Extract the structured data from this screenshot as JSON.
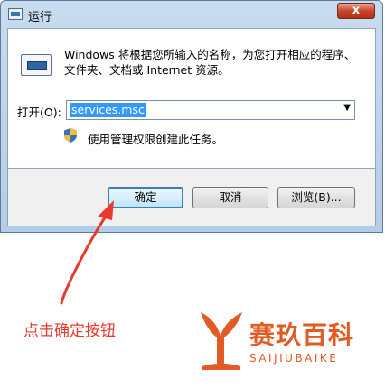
{
  "window": {
    "title": "运行",
    "close_label": "x"
  },
  "dialog": {
    "description": "Windows 将根据您所输入的名称，为您打开相应的程序、文件夹、文档或 Internet 资源。",
    "open_label": "打开(O):",
    "open_value": "services.msc",
    "admin_note": "使用管理权限创建此任务。"
  },
  "buttons": {
    "ok": "确定",
    "cancel": "取消",
    "browse": "浏览(B)..."
  },
  "annotation": {
    "text": "点击确定按钮",
    "color": "#e8392b"
  },
  "watermark": {
    "title": "赛玖百科",
    "subtitle": "SAIJIUBAIKE",
    "color": "#e25a24"
  }
}
